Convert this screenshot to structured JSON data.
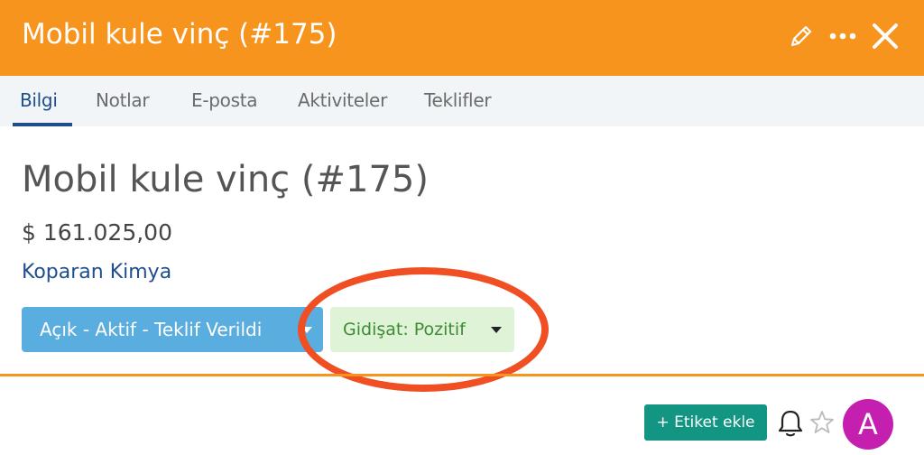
{
  "header": {
    "title": "Mobil kule vinç (#175)",
    "icons": [
      "pencil-icon",
      "more-dots-icon",
      "close-icon"
    ]
  },
  "tabs": [
    {
      "label": "Bilgi",
      "active": true
    },
    {
      "label": "Notlar",
      "active": false
    },
    {
      "label": "E-posta",
      "active": false
    },
    {
      "label": "Aktiviteler",
      "active": false
    },
    {
      "label": "Teklifler",
      "active": false
    }
  ],
  "deal": {
    "title": "Mobil kule vinç (#175)",
    "amount": "$ 161.025,00",
    "company": "Koparan Kimya"
  },
  "status": {
    "label": "Açık - Aktif - Teklif Verildi"
  },
  "outlook": {
    "label": "Gidişat: Pozitif"
  },
  "footer": {
    "add_tag_label": "+ Etiket ekle",
    "avatar_initial": "A"
  },
  "colors": {
    "header_bg": "#f7941d",
    "tab_active": "#1f4e8c",
    "status_bg": "#5aaddf",
    "outlook_bg": "#dff3d6",
    "outlook_text": "#3f8b36",
    "highlight": "#f04e23",
    "tag_bg": "#129683",
    "avatar_bg": "#c51fb0"
  }
}
